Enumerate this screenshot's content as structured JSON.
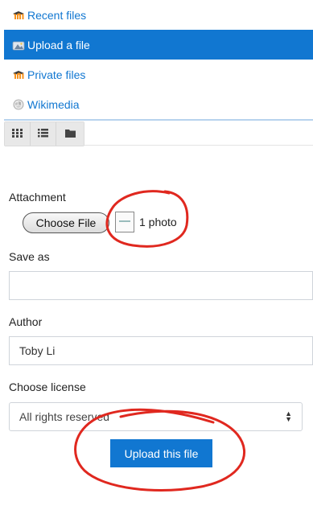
{
  "repositories": [
    {
      "label": "Recent files",
      "icon": "moodle-icon",
      "active": false
    },
    {
      "label": "Upload a file",
      "icon": "upload-icon",
      "active": true
    },
    {
      "label": "Private files",
      "icon": "moodle-icon",
      "active": false
    },
    {
      "label": "Wikimedia",
      "icon": "wikimedia-icon",
      "active": false
    }
  ],
  "view_modes": [
    {
      "icon": "grid-view-icon"
    },
    {
      "icon": "list-view-icon"
    },
    {
      "icon": "folder-view-icon"
    }
  ],
  "form": {
    "attachment_label": "Attachment",
    "choose_file_label": "Choose File",
    "file_count": "1 photo",
    "save_as_label": "Save as",
    "save_as_value": "",
    "author_label": "Author",
    "author_value": "Toby Li",
    "license_label": "Choose license",
    "license_value": "All rights reserved",
    "upload_label": "Upload this file"
  },
  "colors": {
    "accent": "#1177d1",
    "annotation": "#e0281f"
  }
}
